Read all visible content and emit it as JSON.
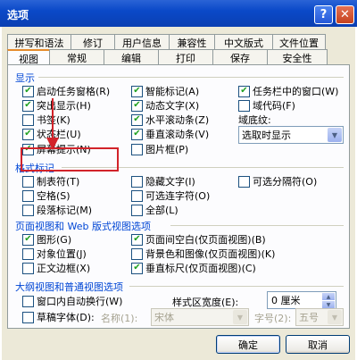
{
  "window": {
    "title": "选项",
    "help_icon": "question-icon",
    "close_icon": "close-icon"
  },
  "tabs_row1": [
    "拼写和语法",
    "修订",
    "用户信息",
    "兼容性",
    "中文版式",
    "文件位置"
  ],
  "tabs_row2": [
    "视图",
    "常规",
    "编辑",
    "打印",
    "保存",
    "安全性"
  ],
  "active_tab": "视图",
  "show": {
    "title": "显示",
    "items": [
      {
        "label": "启动任务窗格(R)",
        "checked": true
      },
      {
        "label": "突出显示(H)",
        "checked": true
      },
      {
        "label": "书签(K)",
        "checked": false
      },
      {
        "label": "状态栏(U)",
        "checked": true
      },
      {
        "label": "屏幕提示(N)",
        "checked": true
      },
      {
        "label": "智能标记(A)",
        "checked": true
      },
      {
        "label": "动态文字(X)",
        "checked": true
      },
      {
        "label": "水平滚动条(Z)",
        "checked": true
      },
      {
        "label": "垂直滚动条(V)",
        "checked": true
      },
      {
        "label": "图片框(P)",
        "checked": false
      },
      {
        "label": "任务栏中的窗口(W)",
        "checked": true
      },
      {
        "label": "域代码(F)",
        "checked": false
      }
    ],
    "field_shading_label": "域底纹:",
    "field_shading_value": "选取时显示"
  },
  "format_marks": {
    "title": "格式标记",
    "items": [
      {
        "label": "制表符(T)",
        "checked": false
      },
      {
        "label": "空格(S)",
        "checked": false
      },
      {
        "label": "段落标记(M)",
        "checked": false
      },
      {
        "label": "隐藏文字(I)",
        "checked": false
      },
      {
        "label": "可选连字符(O)",
        "checked": false
      },
      {
        "label": "全部(L)",
        "checked": false
      },
      {
        "label": "可选分隔符(O)",
        "checked": false
      }
    ]
  },
  "page_web": {
    "title": "页面视图和 Web 版式视图选项",
    "items": [
      {
        "label": "图形(G)",
        "checked": true
      },
      {
        "label": "对象位置(J)",
        "checked": false
      },
      {
        "label": "正文边框(X)",
        "checked": false
      },
      {
        "label": "页面间空白(仅页面视图)(B)",
        "checked": true
      },
      {
        "label": "背景色和图像(仅页面视图)(K)",
        "checked": false
      },
      {
        "label": "垂直标尺(仅页面视图)(C)",
        "checked": true
      }
    ]
  },
  "outline": {
    "title": "大纲视图和普通视图选项",
    "wrap_label": "窗口内自动换行(W)",
    "draft_font_label": "草稿字体(D):",
    "name_label": "名称(1):",
    "name_value": "宋体",
    "size_label": "字号(2):",
    "size_value": "五号",
    "style_width_label": "样式区宽度(E):",
    "style_width_value": "0 厘米"
  },
  "buttons": {
    "ok": "确定",
    "cancel": "取消"
  },
  "colors": {
    "title_bar": "#0a49c8",
    "accent_group": "#0046d5",
    "highlight": "#d2232a"
  }
}
